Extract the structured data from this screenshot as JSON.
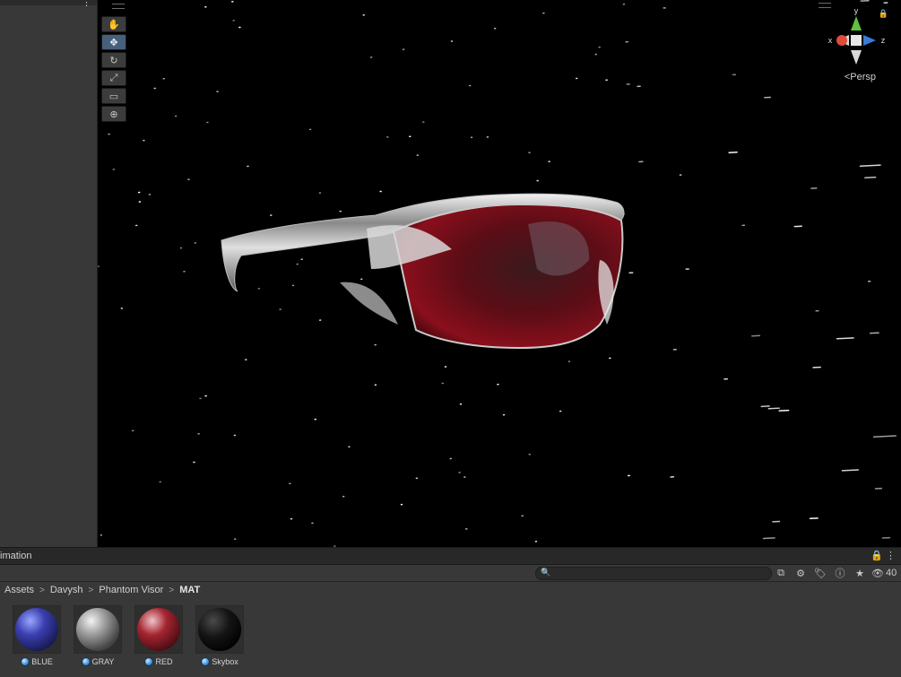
{
  "viewport": {
    "persp_label": "Persp",
    "axis_labels": {
      "x": "x",
      "y": "y",
      "z": "z"
    },
    "tools": [
      "hand-icon",
      "move-icon",
      "rotate-icon",
      "scale-icon",
      "rect-icon",
      "transform-icon"
    ],
    "active_tool_index": 1
  },
  "project": {
    "tab_label": "imation",
    "search": {
      "value": "",
      "placeholder": ""
    },
    "hidden_count": "40",
    "breadcrumb": [
      "Assets",
      "Davysh",
      "Phantom Visor",
      "MAT"
    ],
    "assets": [
      {
        "name": "BLUE"
      },
      {
        "name": "GRAY"
      },
      {
        "name": "RED"
      },
      {
        "name": "Skybox"
      }
    ]
  },
  "colors": {
    "active_tool": "#46607c",
    "viewport_bg": "#000000",
    "panel_bg": "#383838",
    "material_icon": "#3b8fd8"
  }
}
